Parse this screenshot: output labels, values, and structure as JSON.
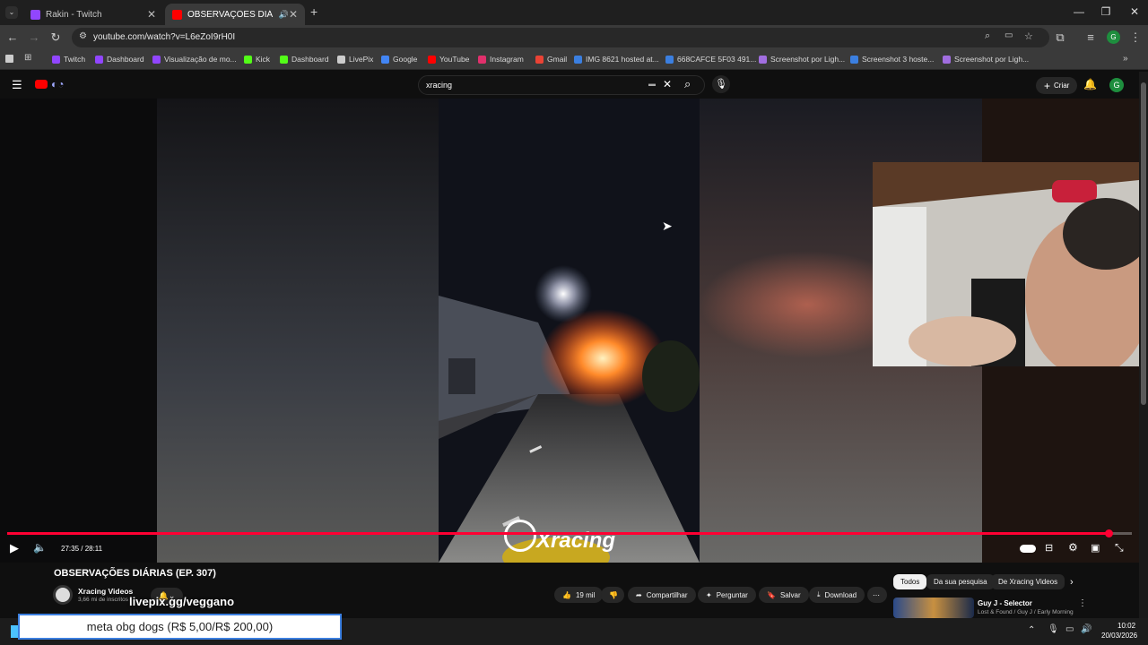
{
  "tabs": [
    {
      "label": "Rakin - Twitch",
      "color": "#9146ff"
    },
    {
      "label": "OBSERVAÇÕES DIÁRIAS (EP.",
      "color": "#ff0000"
    }
  ],
  "address": {
    "url": "youtube.com/watch?v=L6eZoI9rH0I"
  },
  "bookmarks": [
    {
      "label": "Twitch",
      "color": "#9146ff"
    },
    {
      "label": "Dashboard",
      "color": "#9146ff"
    },
    {
      "label": "Visualização de mo...",
      "color": "#9146ff"
    },
    {
      "label": "Kick",
      "color": "#53fc18"
    },
    {
      "label": "Dashboard",
      "color": "#53fc18"
    },
    {
      "label": "LivePix",
      "color": "#cccccc"
    },
    {
      "label": "Google",
      "color": "#4285f4"
    },
    {
      "label": "YouTube",
      "color": "#ff0000"
    },
    {
      "label": "Instagram",
      "color": "#e1306c"
    },
    {
      "label": "Gmail",
      "color": "#ea4335"
    },
    {
      "label": "IMG 8621 hosted at...",
      "color": "#3b7fe0"
    },
    {
      "label": "668CAFCE 5F03 491...",
      "color": "#3b7fe0"
    },
    {
      "label": "Screenshot por Ligh...",
      "color": "#a16ee0"
    },
    {
      "label": "Screenshot 3 hoste...",
      "color": "#3b7fe0"
    },
    {
      "label": "Screenshot por Ligh...",
      "color": "#a16ee0"
    }
  ],
  "youtube": {
    "search_value": "xracing",
    "create_label": "Criar",
    "avatar_letter": "G"
  },
  "player": {
    "time": "27:35 / 28:11",
    "progress": 0.979,
    "watermark": "Xracing"
  },
  "video_info": {
    "title": "OBSERVAÇÕES DIÁRIAS (EP. 307)",
    "channel": "Xracing Videos",
    "subscribers": "3,66 mi de inscritos",
    "likes": "19 mil",
    "share": "Compartilhar",
    "ask": "Perguntar",
    "save": "Salvar",
    "download": "Download"
  },
  "side_chips": [
    "Todos",
    "Da sua pesquisa",
    "De Xracing Videos"
  ],
  "up_next": {
    "title": "Guy J - Selector",
    "subtitle": "Lost & Found / Guy J / Early Morning"
  },
  "overlay": {
    "livepix": "livepix.gg/veggano",
    "meta": "meta obg dogs (R$ 5,00/R$ 200,00)"
  },
  "taskbar": {
    "time": "10:02",
    "date": "20/03/2026"
  }
}
